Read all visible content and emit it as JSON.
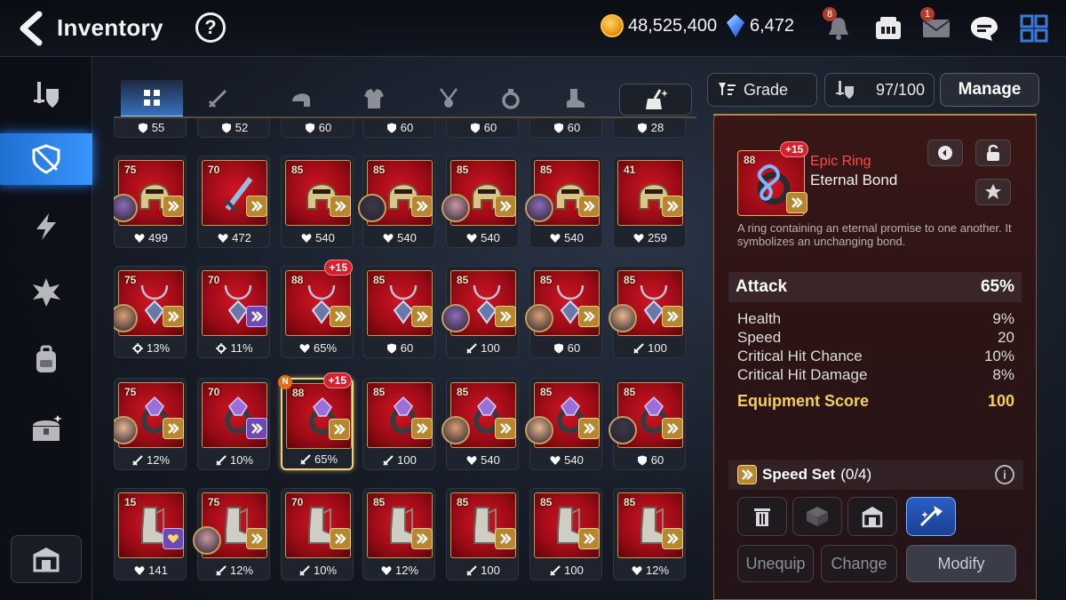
{
  "header": {
    "title": "Inventory",
    "help_label": "?",
    "gold": "48,525,400",
    "crystals": "6,472",
    "bell_badge": "8",
    "mail_badge": "1"
  },
  "sidebar": {
    "items": [
      {
        "name": "equipment-tab",
        "icon": "sword-shield-icon",
        "active": false
      },
      {
        "name": "artifact-tab",
        "icon": "shield-slash-icon",
        "active": true
      },
      {
        "name": "catalyst-tab",
        "icon": "lightning-icon",
        "active": false
      },
      {
        "name": "exclusive-tab",
        "icon": "burst-icon",
        "active": false
      },
      {
        "name": "bag-tab",
        "icon": "backpack-icon",
        "active": false
      },
      {
        "name": "chest-tab",
        "icon": "chest-icon",
        "active": false
      }
    ],
    "bottom_icon": "storehouse-icon"
  },
  "filters": {
    "tabs": [
      "all-icon",
      "weapon-icon",
      "helmet-icon",
      "armor-icon",
      "necklace-icon",
      "ring-icon",
      "boots-icon"
    ],
    "active": 0,
    "filter_icon": "broom-filter-icon"
  },
  "controls": {
    "sort_label": "Grade",
    "capacity": "97/100",
    "manage_label": "Manage"
  },
  "grid": {
    "top_partial_row": [
      "55",
      "52",
      "60",
      "60",
      "60",
      "60",
      "28"
    ],
    "rows": [
      [
        {
          "level": "75",
          "stat": "499",
          "stat_icon": "health",
          "type": "helmet",
          "avatar": true,
          "set": "gold"
        },
        {
          "level": "70",
          "stat": "472",
          "stat_icon": "health",
          "type": "sword",
          "avatar": false,
          "set": "gold"
        },
        {
          "level": "85",
          "stat": "540",
          "stat_icon": "health",
          "type": "helmet",
          "avatar": false,
          "set": "gold"
        },
        {
          "level": "85",
          "stat": "540",
          "stat_icon": "health",
          "type": "helmet",
          "avatar": true,
          "set": "gold"
        },
        {
          "level": "85",
          "stat": "540",
          "stat_icon": "health",
          "type": "helmet",
          "avatar": true,
          "set": "gold"
        },
        {
          "level": "85",
          "stat": "540",
          "stat_icon": "health",
          "type": "helmet",
          "avatar": true,
          "set": "gold"
        },
        {
          "level": "41",
          "stat": "259",
          "stat_icon": "health",
          "type": "helmet",
          "avatar": false,
          "set": "gold"
        }
      ],
      [
        {
          "level": "75",
          "stat": "13%",
          "stat_icon": "gear",
          "type": "necklace",
          "avatar": true,
          "set": "gold"
        },
        {
          "level": "70",
          "stat": "11%",
          "stat_icon": "gear",
          "type": "necklace",
          "avatar": false,
          "set": "purple"
        },
        {
          "level": "88",
          "stat": "65%",
          "stat_icon": "health",
          "type": "necklace",
          "avatar": false,
          "set": "gold",
          "plus": "+15"
        },
        {
          "level": "85",
          "stat": "60",
          "stat_icon": "shield",
          "type": "necklace",
          "avatar": false,
          "set": "gold"
        },
        {
          "level": "85",
          "stat": "100",
          "stat_icon": "sword",
          "type": "necklace",
          "avatar": true,
          "set": "gold"
        },
        {
          "level": "85",
          "stat": "60",
          "stat_icon": "shield",
          "type": "necklace",
          "avatar": true,
          "set": "gold"
        },
        {
          "level": "85",
          "stat": "100",
          "stat_icon": "sword",
          "type": "necklace",
          "avatar": true,
          "set": "gold"
        }
      ],
      [
        {
          "level": "75",
          "stat": "12%",
          "stat_icon": "sword",
          "type": "ring",
          "avatar": true,
          "set": "gold"
        },
        {
          "level": "70",
          "stat": "10%",
          "stat_icon": "sword",
          "type": "ring",
          "avatar": false,
          "set": "purple"
        },
        {
          "level": "88",
          "stat": "65%",
          "stat_icon": "sword",
          "type": "ring",
          "avatar": false,
          "set": "gold",
          "plus": "+15",
          "new": "N",
          "selected": true
        },
        {
          "level": "85",
          "stat": "100",
          "stat_icon": "sword",
          "type": "ring",
          "avatar": false,
          "set": "gold"
        },
        {
          "level": "85",
          "stat": "540",
          "stat_icon": "health",
          "type": "ring",
          "avatar": true,
          "set": "gold"
        },
        {
          "level": "85",
          "stat": "540",
          "stat_icon": "health",
          "type": "ring",
          "avatar": true,
          "set": "gold"
        },
        {
          "level": "85",
          "stat": "60",
          "stat_icon": "shield",
          "type": "ring",
          "avatar": true,
          "set": "gold"
        }
      ],
      [
        {
          "level": "15",
          "stat": "141",
          "stat_icon": "health",
          "type": "boots",
          "avatar": false,
          "set": "heart"
        },
        {
          "level": "75",
          "stat": "12%",
          "stat_icon": "sword",
          "type": "boots",
          "avatar": true,
          "set": "gold"
        },
        {
          "level": "70",
          "stat": "10%",
          "stat_icon": "sword",
          "type": "boots",
          "avatar": false,
          "set": "gold"
        },
        {
          "level": "85",
          "stat": "12%",
          "stat_icon": "health",
          "type": "boots",
          "avatar": false,
          "set": "gold"
        },
        {
          "level": "85",
          "stat": "100",
          "stat_icon": "sword",
          "type": "boots",
          "avatar": false,
          "set": "gold"
        },
        {
          "level": "85",
          "stat": "100",
          "stat_icon": "sword",
          "type": "boots",
          "avatar": false,
          "set": "gold"
        },
        {
          "level": "85",
          "stat": "12%",
          "stat_icon": "health",
          "type": "boots",
          "avatar": false,
          "set": "gold"
        }
      ]
    ]
  },
  "detail": {
    "level": "88",
    "plus": "+15",
    "grade": "Epic Ring",
    "name": "Eternal Bond",
    "description": "A ring containing an eternal promise to one another. It symbolizes an unchanging bond.",
    "main_stat_label": "Attack",
    "main_stat_value": "65%",
    "sub_stats": [
      {
        "label": "Health",
        "value": "9%"
      },
      {
        "label": "Speed",
        "value": "20"
      },
      {
        "label": "Critical Hit Chance",
        "value": "10%"
      },
      {
        "label": "Critical Hit Damage",
        "value": "8%"
      }
    ],
    "score_label": "Equipment Score",
    "score_value": "100",
    "set_label": "Speed Set",
    "set_count": "(0/4)",
    "info_label": "i",
    "unequip_label": "Unequip",
    "change_label": "Change",
    "modify_label": "Modify"
  },
  "colors": {
    "epic": "#ff4b4b",
    "score": "#f2d05a",
    "active_tab": "#3a95ff"
  }
}
